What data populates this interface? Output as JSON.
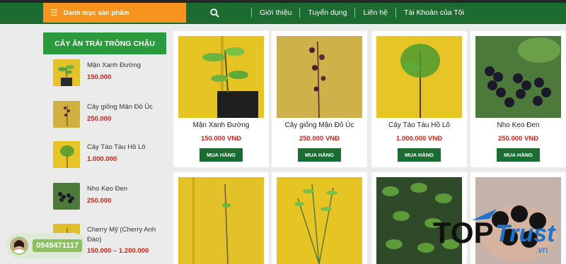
{
  "header": {
    "category_label": "Danh mục sản phẩm",
    "menu": [
      "Giới thiệu",
      "Tuyển dụng",
      "Liên hệ",
      "Tài Khoản của Tôi"
    ]
  },
  "sidebar": {
    "title": "CÂY ĂN TRÁI TRỒNG CHẬU",
    "items": [
      {
        "name": "Mận Xanh Đường",
        "price": "150.000"
      },
      {
        "name": "Cây giống Mận Đỏ Úc",
        "price": "250.000"
      },
      {
        "name": "Cây Táo Tàu Hồ Lô",
        "price": "1.000.000"
      },
      {
        "name": "Nho Kẹo Đen",
        "price": "250.000"
      },
      {
        "name": "Cherry Mỹ (Cherry Anh Đào)",
        "price": "150.000 – 1.200.000"
      }
    ]
  },
  "products": [
    {
      "name": "Mận Xanh Đường",
      "price": "150.000 VNĐ",
      "buy": "MUA HÀNG"
    },
    {
      "name": "Cây giống Mận Đỏ Úc",
      "price": "250.000 VNĐ",
      "buy": "MUA HÀNG"
    },
    {
      "name": "Cây Táo Tàu Hồ Lô",
      "price": "1.000.000 VNĐ",
      "buy": "MUA HÀNG"
    },
    {
      "name": "Nho Kẹo Đen",
      "price": "250.000 VNĐ",
      "buy": "MUA HÀNG"
    }
  ],
  "contact": {
    "phone": "0949471117"
  },
  "watermark": {
    "top": "TOP",
    "trust": "Trust",
    "domain": ".vn"
  },
  "colors": {
    "header_green": "#1c6b31",
    "accent_orange": "#f7941d",
    "price_red": "#c8241c",
    "title_green": "#2b9a3c"
  },
  "icons": {
    "menu": "hamburger-icon",
    "search": "search-icon"
  }
}
